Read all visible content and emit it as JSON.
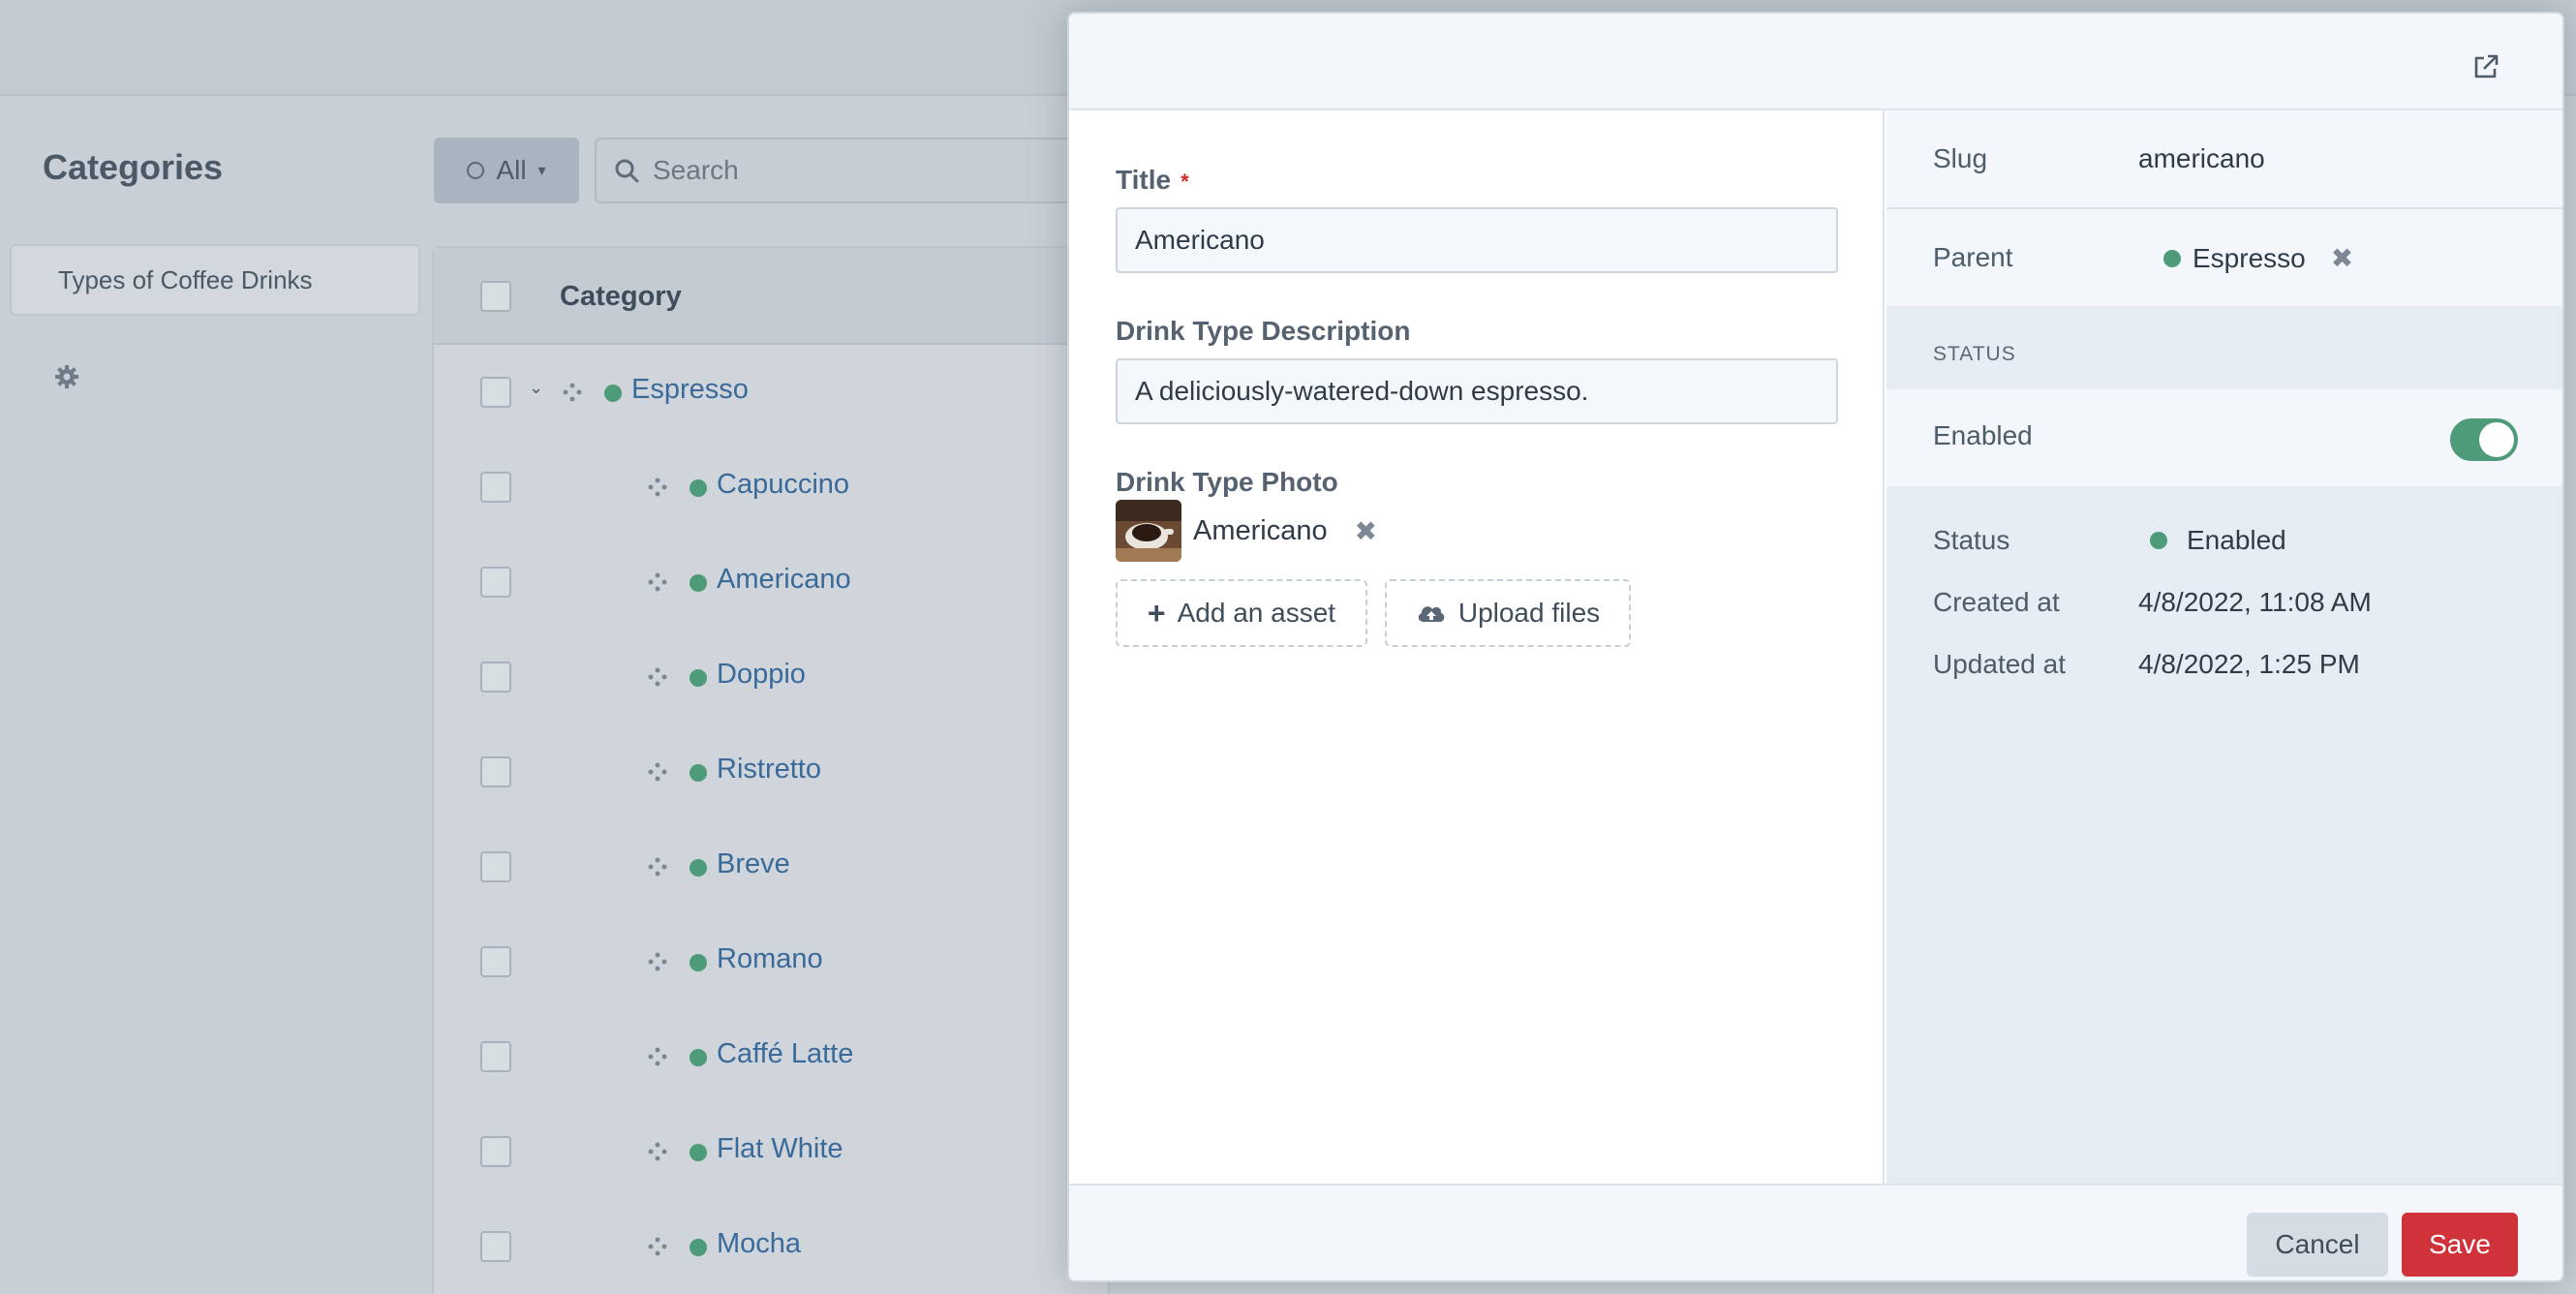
{
  "background": {
    "page_title": "Categories",
    "filter_label": "All",
    "search_placeholder": "Search",
    "sidebar_item": "Types of Coffee Drinks",
    "table_header": "Category",
    "rows": [
      {
        "label": "Espresso",
        "level": 1,
        "expandable": true
      },
      {
        "label": "Capuccino",
        "level": 2
      },
      {
        "label": "Americano",
        "level": 2
      },
      {
        "label": "Doppio",
        "level": 2
      },
      {
        "label": "Ristretto",
        "level": 2
      },
      {
        "label": "Breve",
        "level": 2
      },
      {
        "label": "Romano",
        "level": 2
      },
      {
        "label": "Caffé Latte",
        "level": 2
      },
      {
        "label": "Flat White",
        "level": 2
      },
      {
        "label": "Mocha",
        "level": 2
      }
    ]
  },
  "editor": {
    "title_label": "Title",
    "title_required_mark": "*",
    "title_value": "Americano",
    "description_label": "Drink Type Description",
    "description_value": "A deliciously-watered-down espresso.",
    "photo_label": "Drink Type Photo",
    "photo_asset_name": "Americano",
    "add_asset_label": "Add an asset",
    "upload_label": "Upload files"
  },
  "meta": {
    "slug_label": "Slug",
    "slug_value": "americano",
    "parent_label": "Parent",
    "parent_value": "Espresso",
    "status_heading": "STATUS",
    "enabled_label": "Enabled",
    "enabled_on": true,
    "status_label": "Status",
    "status_value": "Enabled",
    "created_label": "Created at",
    "created_value": "4/8/2022, 11:08 AM",
    "updated_label": "Updated at",
    "updated_value": "4/8/2022, 1:25 PM"
  },
  "footer": {
    "cancel_label": "Cancel",
    "save_label": "Save"
  },
  "colors": {
    "accent_green": "#4e9b79",
    "save_red": "#d03239",
    "link_blue": "#3a6a9a"
  }
}
